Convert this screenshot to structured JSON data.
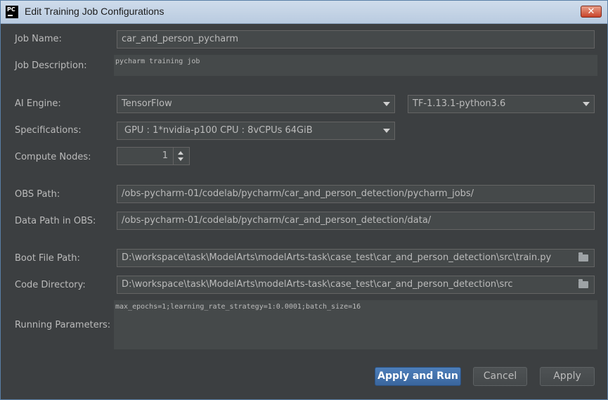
{
  "window": {
    "title": "Edit Training Job Configurations",
    "app_icon_text": "PC"
  },
  "form": {
    "job_name": {
      "label": "Job Name:",
      "value": "car_and_person_pycharm"
    },
    "job_description": {
      "label": "Job Description:",
      "value": "pycharm training job"
    },
    "ai_engine": {
      "label": "AI Engine:",
      "engine": "TensorFlow",
      "version": "TF-1.13.1-python3.6"
    },
    "specifications": {
      "label": "Specifications:",
      "value": "GPU : 1*nvidia-p100 CPU : 8vCPUs 64GiB"
    },
    "compute_nodes": {
      "label": "Compute Nodes:",
      "value": "1"
    },
    "obs_path": {
      "label": "OBS Path:",
      "value": "/obs-pycharm-01/codelab/pycharm/car_and_person_detection/pycharm_jobs/"
    },
    "data_path": {
      "label": "Data Path in OBS:",
      "value": "/obs-pycharm-01/codelab/pycharm/car_and_person_detection/data/"
    },
    "boot_file": {
      "label": "Boot File Path:",
      "value": "D:\\workspace\\task\\ModelArts\\modelArts-task\\case_test\\car_and_person_detection\\src\\train.py"
    },
    "code_directory": {
      "label": "Code Directory:",
      "value": "D:\\workspace\\task\\ModelArts\\modelArts-task\\case_test\\car_and_person_detection\\src"
    },
    "running_parameters": {
      "label": "Running Parameters:",
      "value": "max_epochs=1;learning_rate_strategy=1:0.0001;batch_size=16"
    }
  },
  "buttons": {
    "apply_and_run": "Apply and Run",
    "cancel": "Cancel",
    "apply": "Apply"
  },
  "colors": {
    "background": "#3c3f41",
    "field": "#45494a",
    "primary": "#4d7fba"
  }
}
